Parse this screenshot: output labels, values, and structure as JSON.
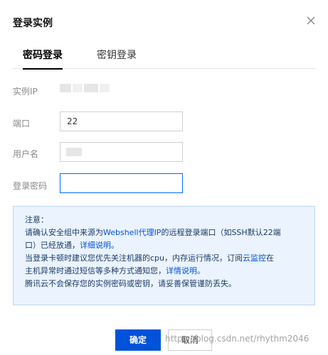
{
  "dialog": {
    "title": "登录实例",
    "close_icon": "close-icon"
  },
  "tabs": [
    {
      "label": "密码登录",
      "active": true
    },
    {
      "label": "密钥登录",
      "active": false
    }
  ],
  "fields": {
    "instance_ip_label": "实例IP",
    "port_label": "端口",
    "port_value": "22",
    "username_label": "用户名",
    "password_label": "登录密码"
  },
  "notice": {
    "heading": "注意：",
    "line1_a": "请确认安全组中来源为",
    "line1_link": "Webshell代理IP",
    "line1_b": "的远程登录端口（如SSH默认22端",
    "line2_a": "口）已经放通，",
    "line2_link": "详细说明。",
    "line3_a": "当登录卡顿时建议您优先关注机器的cpu，内存运行情况，订阅",
    "line3_link": "云监控",
    "line3_b": "在",
    "line4_a": "主机异常时通过短信等多种方式通知您，",
    "line4_link": "详情说明。",
    "line5": "腾讯云不会保存您的实例密码或密钥，请妥善保管谨防丢失。"
  },
  "buttons": {
    "confirm": "确定",
    "cancel": "取消"
  },
  "watermark": "https://blog.csdn.net/rhythm2046",
  "colors": {
    "primary": "#0052d9",
    "focus_border": "#0066ff",
    "notice_bg": "#eaf3fe"
  }
}
